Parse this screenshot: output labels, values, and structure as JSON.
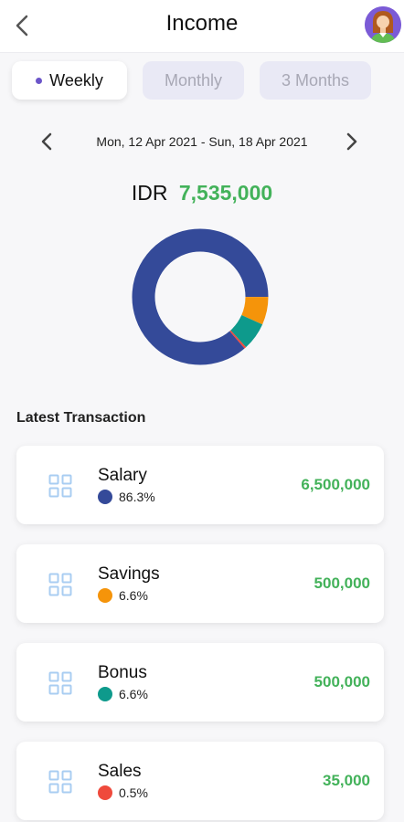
{
  "header": {
    "title": "Income"
  },
  "tabs": [
    {
      "label": "Weekly",
      "active": true
    },
    {
      "label": "Monthly",
      "active": false
    },
    {
      "label": "3 Months",
      "active": false
    }
  ],
  "date_range": "Mon, 12 Apr 2021 - Sun, 18 Apr 2021",
  "total": {
    "currency": "IDR",
    "amount": "7,535,000"
  },
  "section_title": "Latest Transaction",
  "donut": [
    {
      "name": "Salary",
      "fraction": 0.863,
      "color": "#344a99"
    },
    {
      "name": "Savings",
      "fraction": 0.066,
      "color": "#f5940a"
    },
    {
      "name": "Bonus",
      "fraction": 0.066,
      "color": "#0e9a8c"
    },
    {
      "name": "Sales",
      "fraction": 0.005,
      "color": "#ef4a3c"
    }
  ],
  "transactions": [
    {
      "name": "Salary",
      "percent": "86.3%",
      "amount": "6,500,000",
      "color": "#344a99"
    },
    {
      "name": "Savings",
      "percent": "6.6%",
      "amount": "500,000",
      "color": "#f5940a"
    },
    {
      "name": "Bonus",
      "percent": "6.6%",
      "amount": "500,000",
      "color": "#0e9a8c"
    },
    {
      "name": "Sales",
      "percent": "0.5%",
      "amount": "35,000",
      "color": "#ef4a3c"
    }
  ],
  "colors": {
    "accent_green": "#43b25a",
    "tab_dot": "#6b55c9"
  }
}
